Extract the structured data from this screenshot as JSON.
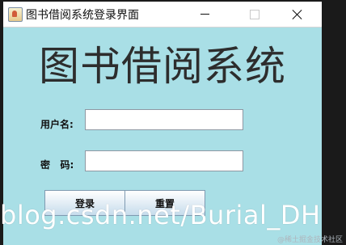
{
  "window": {
    "title": "图书借阅系统登录界面",
    "app_icon": "java-cup-icon",
    "controls": {
      "minimize": "minimize-icon",
      "maximize": "maximize-icon",
      "close": "close-icon"
    }
  },
  "form": {
    "heading": "图书借阅系统",
    "username_label": "用户名:",
    "username_value": "",
    "password_label": "密   码:",
    "password_value": "",
    "login_label": "登录",
    "reset_label": "重置"
  },
  "overlay": {
    "watermark": "blog.csdn.net/Burial_DH",
    "juejin_mark": "@稀土掘金技术社区"
  },
  "colors": {
    "window_bg": "#a9dfe6",
    "titlebar_bg": "#ffffff",
    "outer_bg": "#1a1a1a"
  }
}
